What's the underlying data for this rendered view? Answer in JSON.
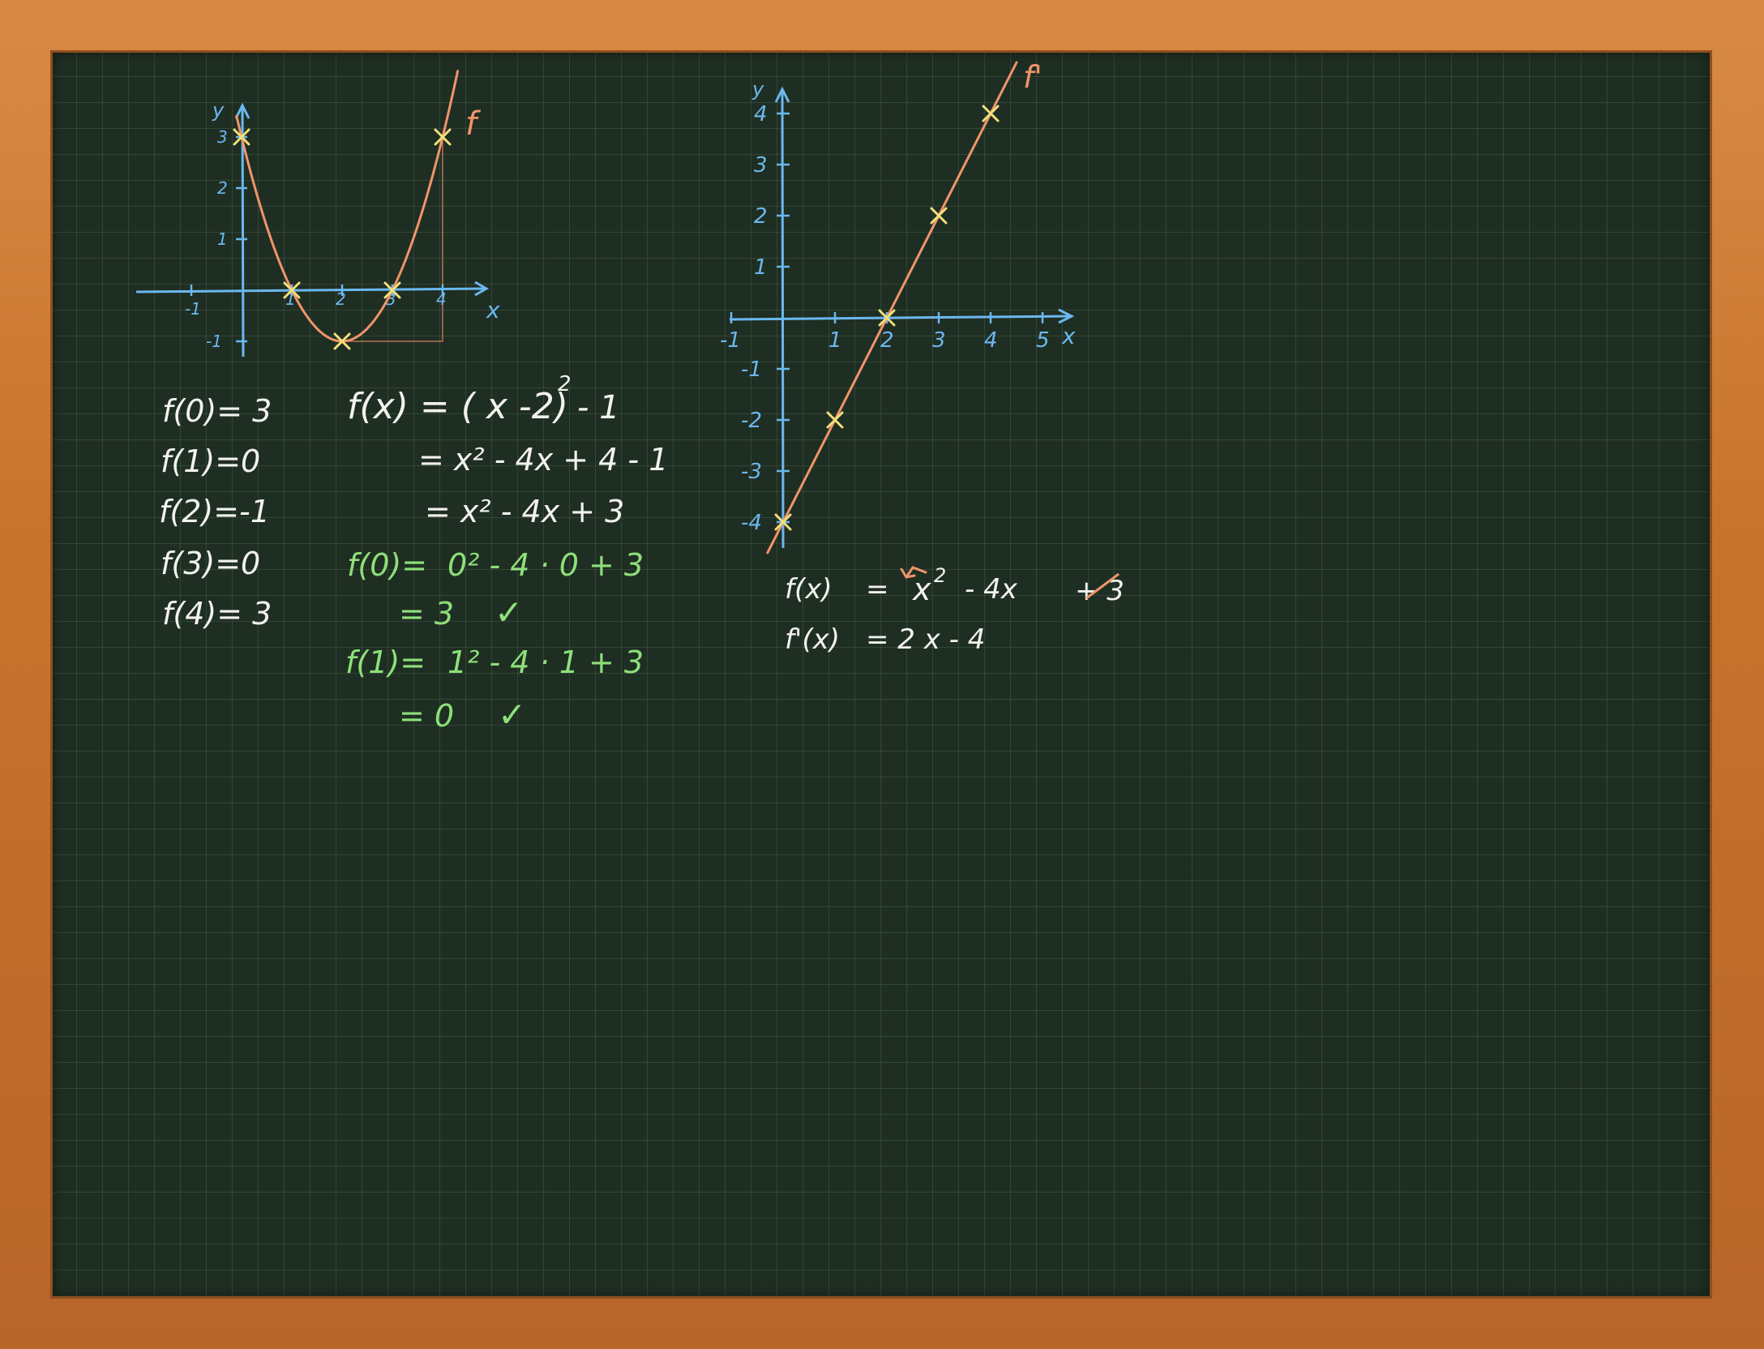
{
  "colors": {
    "board": "#1f2e22",
    "frame": "#c8732c",
    "chalk_white": "#f2f2ee",
    "chalk_green": "#8ee07a",
    "axis_blue": "#6bb8f0",
    "curve_orange": "#f0946a",
    "mark_yellow": "#f2e07a"
  },
  "graph1": {
    "x_label": "x",
    "y_label": "y",
    "curve_label": "f",
    "x_ticks": [
      "-1",
      "1",
      "2",
      "3",
      "4"
    ],
    "y_ticks": [
      "3",
      "2",
      "1",
      "-1"
    ]
  },
  "graph2": {
    "x_label": "x",
    "y_label": "y",
    "curve_label": "f'",
    "x_ticks": [
      "-1",
      "1",
      "2",
      "3",
      "4",
      "5"
    ],
    "y_ticks": [
      "4",
      "3",
      "2",
      "1",
      "-1",
      "-2",
      "-3",
      "-4"
    ]
  },
  "values": [
    "f(0)= 3",
    "f(1)=0",
    "f(2)=-1",
    "f(3)=0",
    "f(4)= 3"
  ],
  "expansion": {
    "line1_lhs": "f(x) = ( x -2)",
    "line1_exp": "2",
    "line1_rhs": "- 1",
    "line2": "= x² - 4x + 4  - 1",
    "line3": "= x² - 4x + 3"
  },
  "checks": {
    "c1_lhs": "f(0)=",
    "c1_rhs": "0² - 4 · 0 + 3",
    "c1_result": "=  3",
    "c2_lhs": "f(1)=",
    "c2_rhs": "1² - 4 · 1 + 3",
    "c2_result": "=  0",
    "check_mark": "✓"
  },
  "derivative": {
    "line1_lhs": "f(x)",
    "line1_eq": "=",
    "line1_term1": "x",
    "line1_exp": "2",
    "line1_term2": "- 4x",
    "line1_term3": "+ 3",
    "line2_lhs": "f'(x)",
    "line2_rhs": "= 2 x - 4"
  },
  "chart_data": [
    {
      "type": "line",
      "title": "",
      "xlabel": "x",
      "ylabel": "y",
      "xlim": [
        -1,
        4.5
      ],
      "ylim": [
        -1,
        3.5
      ],
      "series": [
        {
          "name": "f",
          "x": [
            0,
            0.5,
            1,
            1.5,
            2,
            2.5,
            3,
            3.5,
            4
          ],
          "y": [
            3,
            1.25,
            0,
            -0.75,
            -1,
            -0.75,
            0,
            1.25,
            3
          ]
        }
      ],
      "marked_points": [
        [
          0,
          3
        ],
        [
          1,
          0
        ],
        [
          2,
          -1
        ],
        [
          3,
          0
        ],
        [
          4,
          3
        ]
      ]
    },
    {
      "type": "line",
      "title": "",
      "xlabel": "x",
      "ylabel": "y",
      "xlim": [
        -1,
        5.5
      ],
      "ylim": [
        -4.5,
        4.5
      ],
      "series": [
        {
          "name": "f'",
          "x": [
            -0.3,
            4.5
          ],
          "y": [
            -4.6,
            5
          ]
        }
      ],
      "marked_points": [
        [
          0,
          -4
        ],
        [
          1,
          -2
        ],
        [
          2,
          0
        ],
        [
          3,
          2
        ],
        [
          4,
          4
        ]
      ]
    }
  ]
}
